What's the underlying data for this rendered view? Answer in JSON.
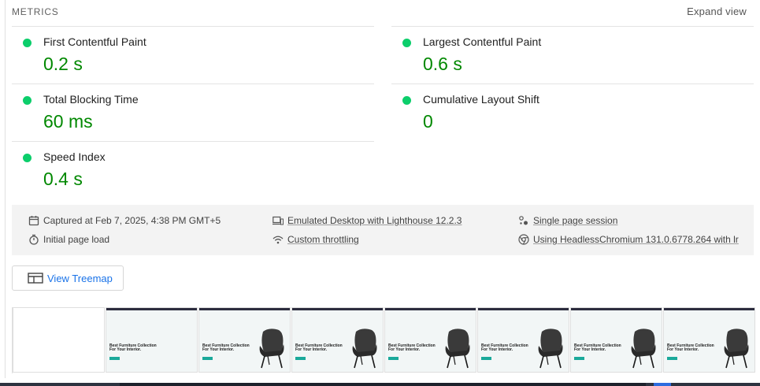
{
  "header": {
    "title": "METRICS",
    "expand_label": "Expand view"
  },
  "metrics": [
    {
      "label": "First Contentful Paint",
      "value": "0.2 s",
      "status": "pass"
    },
    {
      "label": "Largest Contentful Paint",
      "value": "0.6 s",
      "status": "pass"
    },
    {
      "label": "Total Blocking Time",
      "value": "60 ms",
      "status": "pass"
    },
    {
      "label": "Cumulative Layout Shift",
      "value": "0",
      "status": "pass"
    },
    {
      "label": "Speed Index",
      "value": "0.4 s",
      "status": "pass"
    }
  ],
  "info": {
    "captured": "Captured at Feb 7, 2025, 4:38 PM GMT+5",
    "initial_load": "Initial page load",
    "emulated": "Emulated Desktop with Lighthouse 12.2.3",
    "throttling": "Custom throttling",
    "session": "Single page session",
    "browser": "Using HeadlessChromium 131.0.6778.264 with lr"
  },
  "treemap": {
    "label": "View Treemap"
  },
  "filmstrip": {
    "frame_heading": "Best Furniture Collection For Your Interior.",
    "frames": 8
  },
  "colors": {
    "pass": "#0cce6b",
    "pass_text": "#008800",
    "link": "#1a73e8"
  }
}
